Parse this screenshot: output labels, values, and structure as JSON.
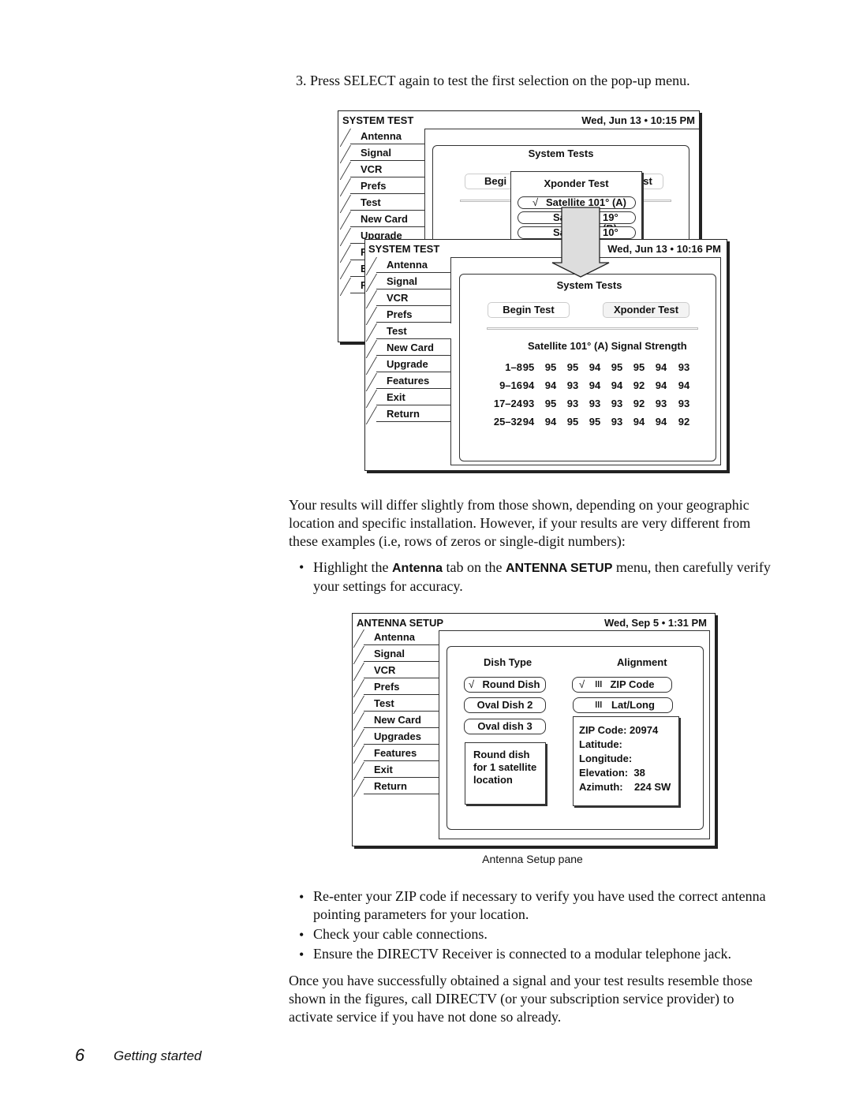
{
  "step3": "3. Press SELECT again to test the first selection on the pop-up menu.",
  "fig1_back": {
    "title": "SYSTEM TEST",
    "datetime": "Wed, Jun 13 • 10:15 PM",
    "tabs": [
      "Antenna",
      "Signal",
      "VCR",
      "Prefs",
      "Test",
      "New Card",
      "Upgrade",
      "F",
      "E",
      "R"
    ],
    "panel_title": "System Tests",
    "begin_partial": "Begi",
    "xponder_partial": "est",
    "popup": {
      "title": "Xponder Test",
      "check": "√",
      "options": [
        "Satellite 101° (A)",
        "Sa",
        "19° (B)",
        "Sa",
        "10° (C)"
      ]
    }
  },
  "fig1_front": {
    "title": "SYSTEM TEST",
    "datetime": "Wed, Jun 13 • 10:16 PM",
    "tabs": [
      "Antenna",
      "Signal",
      "VCR",
      "Prefs",
      "Test",
      "New Card",
      "Upgrade",
      "Features",
      "Exit",
      "Return"
    ],
    "active_tab": "Test",
    "panel_title": "System Tests",
    "begin_test": "Begin Test",
    "xponder_test": "Xponder Test",
    "signal_title": "Satellite 101° (A) Signal Strength",
    "rows": [
      {
        "label": "1–8",
        "values": [
          "95",
          "95",
          "95",
          "94",
          "95",
          "95",
          "94",
          "93"
        ]
      },
      {
        "label": "9–16",
        "values": [
          "94",
          "94",
          "93",
          "94",
          "94",
          "92",
          "94",
          "94"
        ]
      },
      {
        "label": "17–24",
        "values": [
          "93",
          "95",
          "93",
          "93",
          "93",
          "92",
          "93",
          "93"
        ]
      },
      {
        "label": "25–32",
        "values": [
          "94",
          "94",
          "95",
          "95",
          "93",
          "94",
          "94",
          "92"
        ]
      }
    ]
  },
  "para1": "Your results will differ slightly from those shown, depending on your geographic location and specific installation. However, if your results are very different from these examples (i.e, rows of zeros or single-digit numbers):",
  "bullet1": {
    "a": "Highlight the ",
    "b": "Antenna",
    "c": " tab on the ",
    "d": "ANTENNA SETUP",
    "e": " menu, then carefully verify your settings for accuracy."
  },
  "fig2": {
    "title": "ANTENNA SETUP",
    "datetime": "Wed, Sep 5 • 1:31 PM",
    "tabs": [
      "Antenna",
      "Signal",
      "VCR",
      "Prefs",
      "Test",
      "New Card",
      "Upgrades",
      "Features",
      "Exit",
      "Return"
    ],
    "active_tab": "Antenna",
    "dish_type": "Dish Type",
    "alignment": "Alignment",
    "check": "√",
    "dish_options": [
      "Round Dish",
      "Oval Dish 2",
      "Oval dish 3"
    ],
    "dish_desc": "Round dish for 1 satellite location",
    "align_options": [
      "ZIP Code",
      "Lat/Long"
    ],
    "info": [
      "ZIP Code: 20974",
      "Latitude:",
      "Longitude:",
      "Elevation:  38",
      "Azimuth:    224 SW"
    ],
    "caption": "Antenna Setup pane"
  },
  "bullets2": [
    "Re-enter your ZIP code if necessary to verify you have used the correct antenna pointing parameters for your location.",
    "Check your cable connections.",
    "Ensure the DIRECTV Receiver is connected to a modular telephone jack."
  ],
  "para2": "Once you have successfully obtained a signal and your test results resemble those shown in the figures, call DIRECTV (or your subscription service provider) to activate service if you have not done so already.",
  "footer": {
    "page_number": "6",
    "section": "Getting started"
  }
}
